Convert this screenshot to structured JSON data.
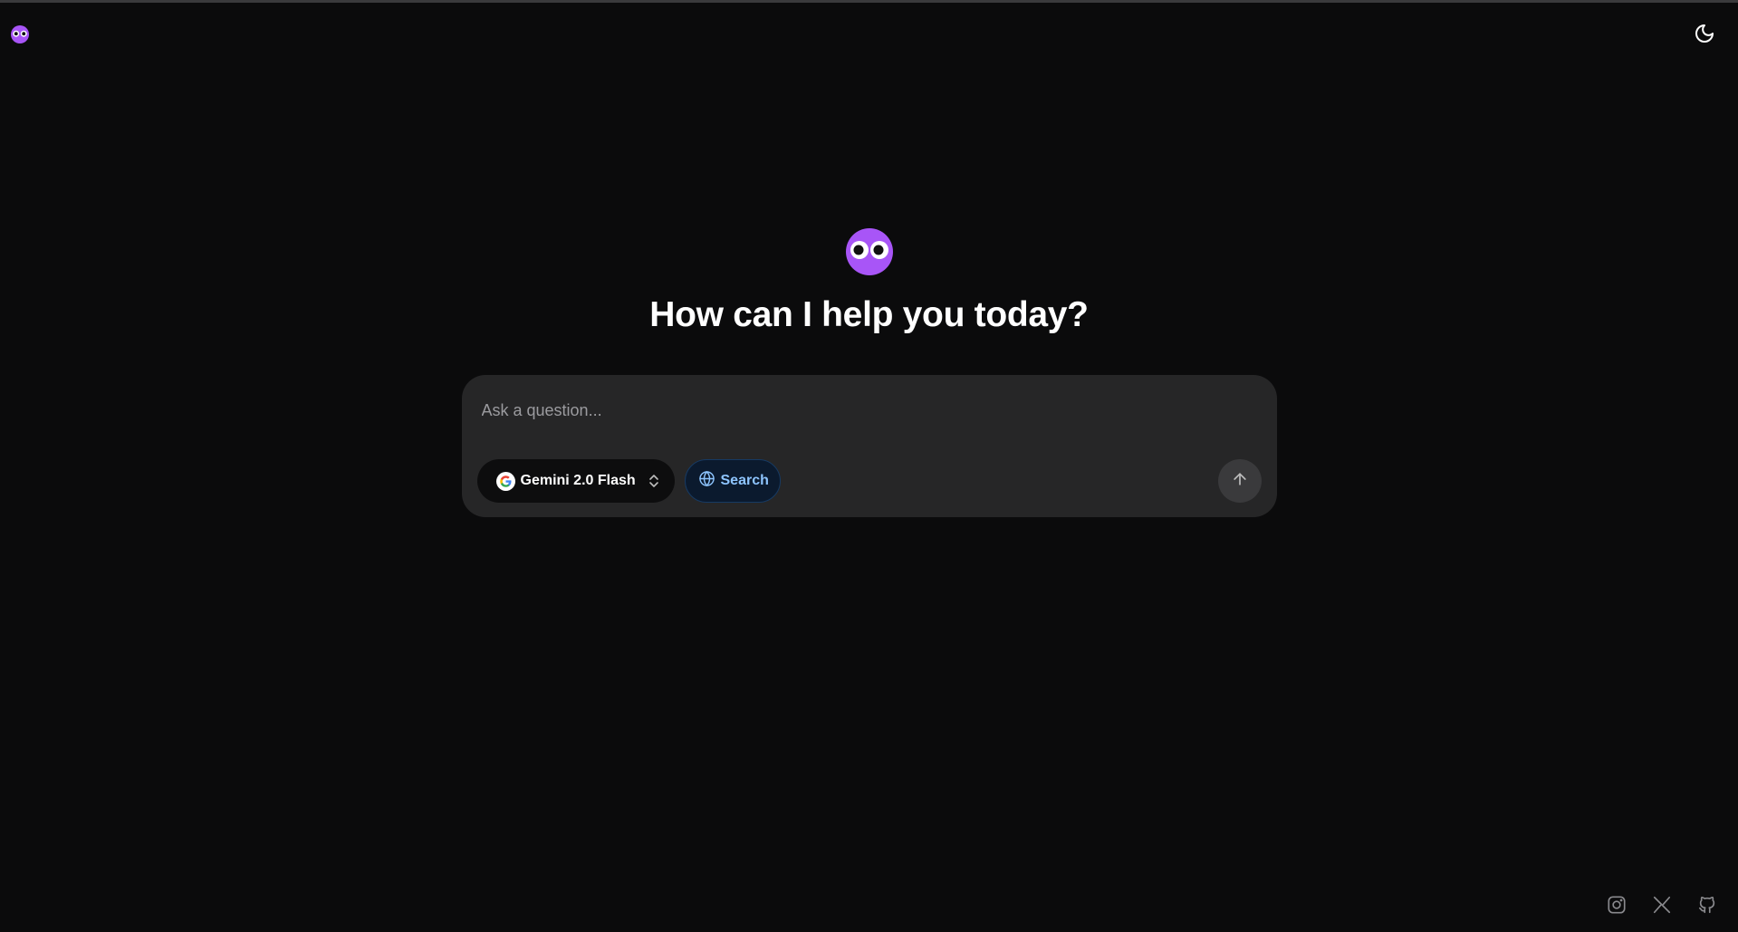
{
  "header": {
    "logo_icon": "googly-eyes-logo-icon",
    "theme_toggle_icon": "moon-icon"
  },
  "hero": {
    "logo_icon": "googly-eyes-logo-icon",
    "title": "How can I help you today?"
  },
  "composer": {
    "placeholder": "Ask a question...",
    "model": {
      "label": "Gemini 2.0 Flash",
      "icon": "google-icon"
    },
    "search": {
      "label": "Search",
      "icon": "globe-icon"
    },
    "send_icon": "arrow-up-icon"
  },
  "footer": {
    "links": [
      "instagram-icon",
      "x-icon",
      "github-icon"
    ]
  },
  "colors": {
    "background": "#0b0b0c",
    "composer_bg": "#262627",
    "brand_purple": "#a855f7",
    "search_accent": "#8ec5ff"
  }
}
